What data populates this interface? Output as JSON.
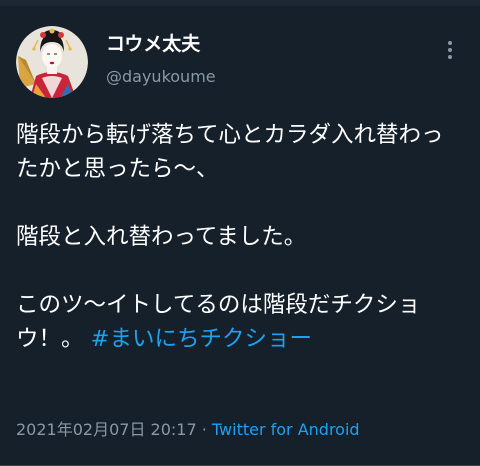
{
  "author": {
    "display_name": "コウメ太夫",
    "handle": "@dayukoume"
  },
  "tweet": {
    "line1": "階段から転げ落ちて心とカラダ入れ替わったかと思ったら〜、",
    "line2": "階段と入れ替わってました。",
    "line3_text": "このツ〜イトしてるのは階段だチクショウ！。 ",
    "hashtag": "#まいにちチクショー"
  },
  "meta": {
    "timestamp": "2021年02月07日 20:17",
    "separator": " · ",
    "source": "Twitter for Android"
  },
  "icons": {
    "more": "more-vertical-icon",
    "avatar": "avatar-image"
  },
  "colors": {
    "background": "#15202b",
    "text": "#ffffff",
    "secondary": "#8899a6",
    "accent": "#1da1f2"
  }
}
